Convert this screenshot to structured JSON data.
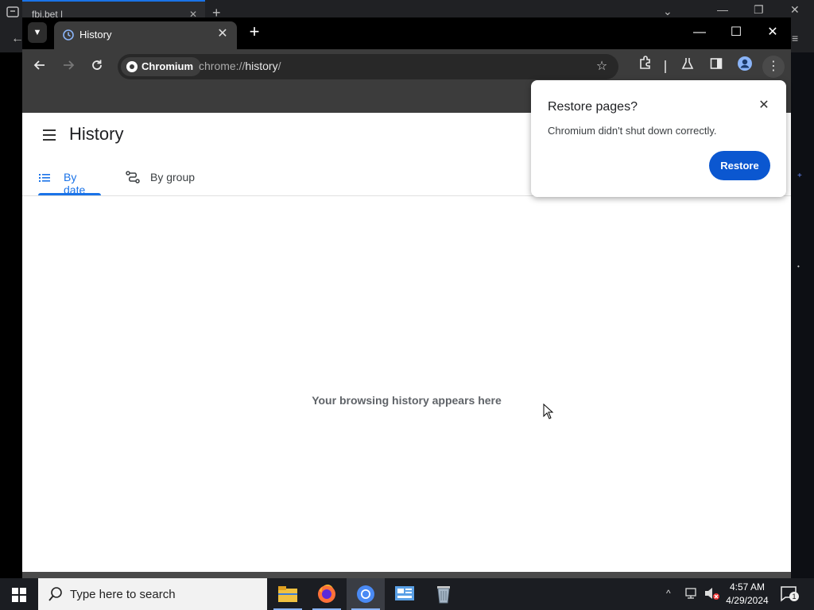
{
  "background_window": {
    "tab_title": "fbi.bet |"
  },
  "window": {
    "tab": {
      "title": "History",
      "favicon": "history-icon"
    },
    "new_tab": "+",
    "controls": {
      "minimize": "—",
      "maximize": "☐",
      "close": "✕"
    }
  },
  "toolbar": {
    "chip_label": "Chromium",
    "url_scheme": "chrome://",
    "url_host": "history",
    "url_suffix": "/"
  },
  "page": {
    "title": "History",
    "tabs": [
      {
        "label": "By date",
        "selected": true
      },
      {
        "label": "By group",
        "selected": false
      }
    ],
    "empty_message": "Your browsing history appears here"
  },
  "restore_popup": {
    "title": "Restore pages?",
    "message": "Chromium didn't shut down correctly.",
    "button": "Restore"
  },
  "taskbar": {
    "search_placeholder": "Type here to search",
    "time": "4:57 AM",
    "date": "4/29/2024",
    "notifications": "1"
  },
  "colors": {
    "accent": "#1a73e8",
    "restore_button": "#0b57d0",
    "toolbar": "#3c3c3c",
    "titlebar": "#000000"
  }
}
